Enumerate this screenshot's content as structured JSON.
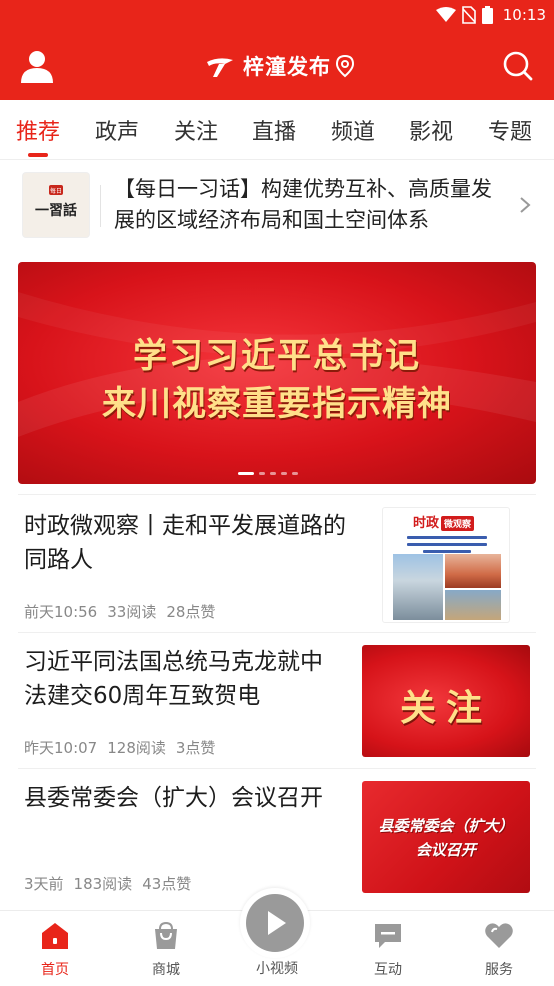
{
  "status_bar": {
    "time": "10:13",
    "icons": [
      "wifi-icon",
      "no-sim-icon",
      "battery-icon"
    ]
  },
  "header": {
    "logo_text": "梓潼发布",
    "icons": [
      "user-icon",
      "location-pin-icon",
      "search-icon"
    ]
  },
  "tabs": [
    {
      "label": "推荐",
      "active": true
    },
    {
      "label": "政声",
      "active": false
    },
    {
      "label": "关注",
      "active": false
    },
    {
      "label": "直播",
      "active": false
    },
    {
      "label": "频道",
      "active": false
    },
    {
      "label": "影视",
      "active": false
    },
    {
      "label": "专题",
      "active": false
    }
  ],
  "daily": {
    "thumb_text": "一習話",
    "thumb_badge": "每日",
    "text": "【每日一习话】构建优势互补、高质量发展的区域经济布局和国土空间体系"
  },
  "hero": {
    "line1": "学习习近平总书记",
    "line2": "来川视察重要指示精神",
    "slide_count": 5,
    "active_slide": 1
  },
  "articles": [
    {
      "title": "时政微观察丨走和平发展道路的同路人",
      "time": "前天10:56",
      "reads": "33阅读",
      "likes": "28点赞",
      "thumb": {
        "head": "时政",
        "badge": "微观察"
      }
    },
    {
      "title": "习近平同法国总统马克龙就中法建交60周年互致贺电",
      "time": "昨天10:07",
      "reads": "128阅读",
      "likes": "3点赞",
      "thumb": {
        "text": "关注"
      }
    },
    {
      "title": "县委常委会（扩大）会议召开",
      "time": "3天前",
      "reads": "183阅读",
      "likes": "43点赞",
      "thumb": {
        "line1": "县委常委会（扩大）",
        "line2": "会议召开"
      }
    }
  ],
  "bottom_nav": [
    {
      "label": "首页",
      "icon": "home-icon",
      "active": true
    },
    {
      "label": "商城",
      "icon": "shopping-bag-icon",
      "active": false
    },
    {
      "label": "小视频",
      "icon": "play-icon",
      "active": false
    },
    {
      "label": "互动",
      "icon": "chat-icon",
      "active": false
    },
    {
      "label": "服务",
      "icon": "heart-icon",
      "active": false
    }
  ],
  "colors": {
    "brand_red": "#e8251a",
    "gold_text": "#ffe08a",
    "meta_gray": "#888888"
  }
}
